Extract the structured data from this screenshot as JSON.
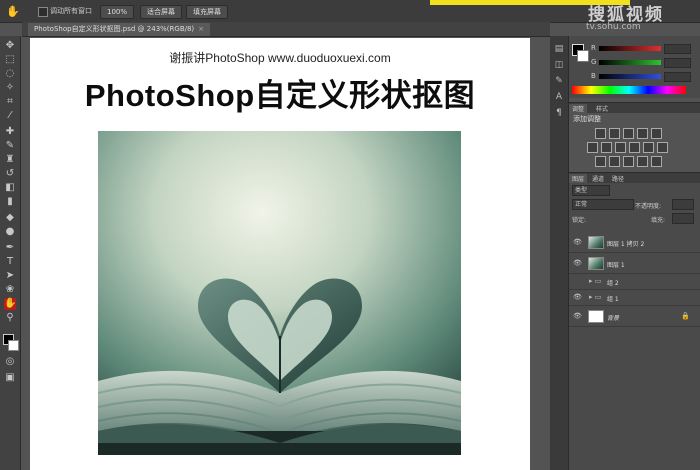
{
  "option_bar": {
    "checkbox_label": "调动所有窗口",
    "btn_100": "100%",
    "btn_fit": "适合屏幕",
    "btn_fill": "填充屏幕"
  },
  "watermark": {
    "logo": "搜狐视频",
    "url": "tv.sohu.com"
  },
  "document": {
    "tab_title": "PhotoShop自定义形状抠图.psd @ 243%(RGB/8)",
    "close_label": "×"
  },
  "canvas": {
    "subtitle": "谢振讲PhotoShop www.duoduoxuexi.com",
    "title": "PhotoShop自定义形状抠图"
  },
  "panels": {
    "color_tabs": [
      "颜色",
      "色板"
    ],
    "rgb_labels": [
      "R",
      "G",
      "B"
    ],
    "adjust_tabs": [
      "调整",
      "样式"
    ],
    "adjust_title": "添加调整",
    "layer_tabs": [
      "图层",
      "通道",
      "路径"
    ],
    "kind_label": "类型",
    "blend_mode": "正常",
    "opacity_label": "不透明度:",
    "lock_label": "锁定:",
    "fill_label": "填充:",
    "layers": [
      {
        "name": "图层 1 拷贝 2",
        "type": "image",
        "visible": true
      },
      {
        "name": "图层 1",
        "type": "image",
        "visible": true
      },
      {
        "name": "组 2",
        "type": "group",
        "visible": false
      },
      {
        "name": "组 1",
        "type": "group",
        "visible": true
      },
      {
        "name": "背景",
        "type": "background",
        "visible": true
      }
    ]
  },
  "colors": {
    "active_tool": "#b81d1d",
    "highlight": "#f0e020",
    "slider_r": "#e03030",
    "slider_g": "#30c030",
    "slider_b": "#3050e0"
  }
}
